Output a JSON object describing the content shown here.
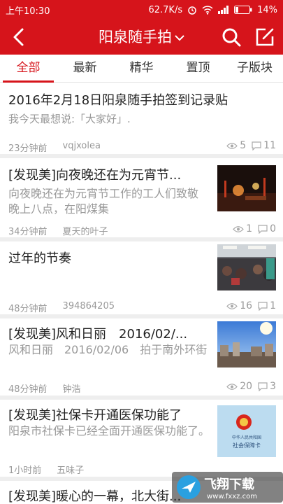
{
  "status_bar": {
    "time": "上午10:30",
    "speed": "62.7K/s",
    "battery": "14%",
    "icons": [
      "alarm-icon",
      "wifi-icon",
      "signal-icon",
      "battery-icon"
    ]
  },
  "header": {
    "title": "阳泉随手拍",
    "back_icon": "back-arrow-icon",
    "search_icon": "search-icon",
    "edit_icon": "edit-icon",
    "dropdown_icon": "chevron-down-icon"
  },
  "tabs": [
    {
      "label": "全部",
      "active": true
    },
    {
      "label": "最新",
      "active": false
    },
    {
      "label": "精华",
      "active": false
    },
    {
      "label": "置顶",
      "active": false
    },
    {
      "label": "子版块",
      "active": false
    }
  ],
  "posts": [
    {
      "title": "2016年2月18日阳泉随手拍签到记录贴",
      "excerpt": "我今天最想说:「大家好」.",
      "time": "23分钟前",
      "author": "vqjxolea",
      "views": "5",
      "comments": "11"
    },
    {
      "title": "[发现美]向夜晚还在为元宵节...",
      "excerpt": "向夜晚还在为元宵节工作的工人们致敬 晚上八点，在阳煤集",
      "time": "34分钟前",
      "author": "夏天的叶子",
      "views": "1",
      "comments": "0"
    },
    {
      "title": "过年的节奏",
      "excerpt": "",
      "time": "48分钟前",
      "author": "394864205",
      "views": "16",
      "comments": "1"
    },
    {
      "title": "[发现美]风和日丽　2016/02/...",
      "excerpt": "风和日丽　2016/02/06　拍于南外环街",
      "time": "48分钟前",
      "author": "钟浩",
      "views": "20",
      "comments": "3"
    },
    {
      "title": "[发现美]社保卡开通医保功能了",
      "excerpt": "阳泉市社保卡已经全面开通医保功能了。",
      "time": "1小时前",
      "author": "五味子",
      "views": "",
      "comments": "",
      "card_text": "社会保障卡",
      "card_small": "中华人民共和国"
    },
    {
      "title": "[发现美]暖心的一幕，北大街...",
      "excerpt": "",
      "time": "",
      "author": "",
      "views": "",
      "comments": ""
    }
  ],
  "watermark": {
    "text": "飞翔下载",
    "url": "www.fxxz.com"
  },
  "colors": {
    "brand_red": "#d6141b",
    "muted": "#999999",
    "text": "#222222",
    "divider": "#eeeeee"
  }
}
